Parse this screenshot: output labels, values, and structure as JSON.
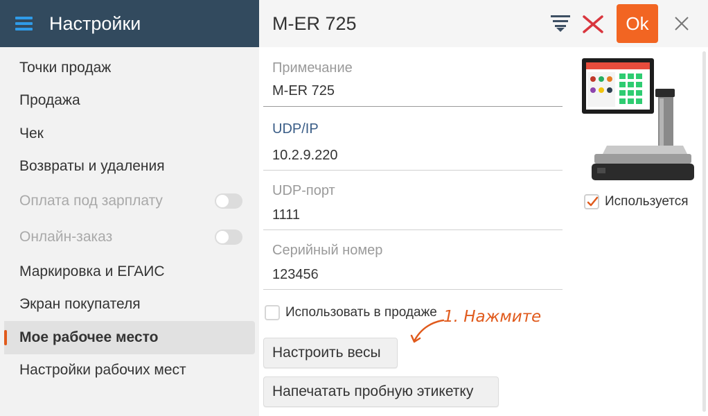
{
  "sidebar": {
    "title": "Настройки",
    "items": [
      {
        "label": "Точки продаж",
        "state": "normal"
      },
      {
        "label": "Продажа",
        "state": "normal"
      },
      {
        "label": "Чек",
        "state": "normal"
      },
      {
        "label": "Возвраты и удаления",
        "state": "normal"
      },
      {
        "label": "Оплата под зарплату",
        "state": "disabled",
        "toggle": false
      },
      {
        "label": "Онлайн-заказ",
        "state": "disabled",
        "toggle": false
      },
      {
        "label": "Маркировка и ЕГАИС",
        "state": "normal"
      },
      {
        "label": "Экран покупателя",
        "state": "normal"
      },
      {
        "label": "Мое рабочее место",
        "state": "active"
      },
      {
        "label": "Настройки рабочих мест",
        "state": "normal"
      }
    ]
  },
  "header": {
    "title": "M-ER 725",
    "ok_label": "Ok",
    "icons": [
      "filter-icon",
      "close-red-icon",
      "close-icon"
    ]
  },
  "form": {
    "note_label": "Примечание",
    "note_value": "M-ER 725",
    "ip_label": "UDP/IP",
    "ip_value": "10.2.9.220",
    "port_label": "UDP-порт",
    "port_value": "1111",
    "serial_label": "Серийный номер",
    "serial_value": "123456",
    "use_in_sale_label": "Использовать в продаже",
    "use_in_sale_checked": false,
    "used_label": "Используется",
    "used_checked": true
  },
  "annotation": {
    "text": "1. Нажмите"
  },
  "buttons": {
    "configure_scales": "Настроить весы",
    "print_test_label": "Напечатать пробную этикетку"
  },
  "colors": {
    "sidebar_header": "#324a5e",
    "accent": "#f26522",
    "hamburger": "#2f9be8",
    "active_marker": "#e05a1c",
    "label_blue": "#3a5d87"
  }
}
